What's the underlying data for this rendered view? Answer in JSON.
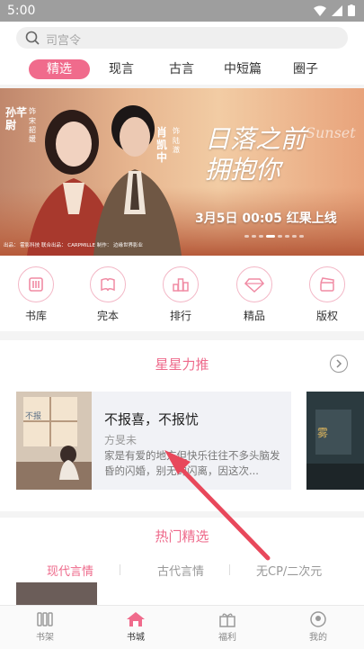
{
  "status": {
    "time": "5:00"
  },
  "search": {
    "placeholder": "司宫令"
  },
  "tabs": [
    {
      "label": "精选",
      "active": true
    },
    {
      "label": "现言"
    },
    {
      "label": "古言"
    },
    {
      "label": "中短篇"
    },
    {
      "label": "圈子"
    }
  ],
  "banner": {
    "title_art": "日落之前 拥抱你",
    "title_en": "Sunset",
    "actor1": "孙芊尉",
    "role1": "宋韶媛",
    "actor2": "肖凯中",
    "role2": "陆澈",
    "role_prefix": "饰",
    "release": "3月5日 00:05 红果上线",
    "credits": "出品：  霍影科技   联合出品：  CARPMILLE     制作：  边缘世界影业"
  },
  "categories": [
    {
      "label": "书库",
      "icon": "library-icon"
    },
    {
      "label": "完本",
      "icon": "finished-book-icon"
    },
    {
      "label": "排行",
      "icon": "ranking-icon"
    },
    {
      "label": "精品",
      "icon": "diamond-icon"
    },
    {
      "label": "版权",
      "icon": "copyright-clapper-icon"
    }
  ],
  "featured": {
    "title": "星星力推",
    "book": {
      "title": "不报喜，不报忧",
      "author": "方旻未",
      "desc": "家是有爱的地方但快乐往往不多头脑发昏的闪婚，别无的闪离，因这次..."
    }
  },
  "hot": {
    "title": "热门精选",
    "subtabs": [
      {
        "label": "现代言情",
        "active": true
      },
      {
        "label": "古代言情"
      },
      {
        "label": "无CP/二次元"
      }
    ]
  },
  "bottom_nav": [
    {
      "label": "书架",
      "icon": "bookshelf-icon"
    },
    {
      "label": "书城",
      "icon": "bookstore-home-icon",
      "active": true
    },
    {
      "label": "福利",
      "icon": "gift-icon"
    },
    {
      "label": "我的",
      "icon": "profile-icon"
    }
  ],
  "colors": {
    "accent": "#f06b8c",
    "statusbar": "#9e9e9e",
    "annotation_arrow": "#e8485b"
  }
}
